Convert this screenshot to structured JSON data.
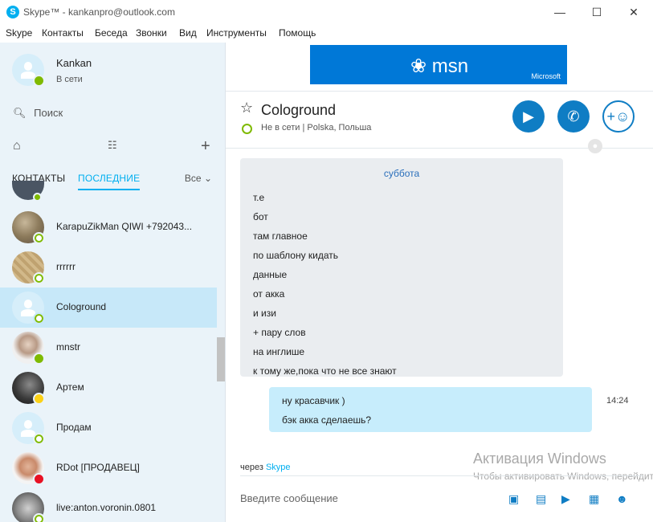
{
  "window": {
    "title": "Skype™ - kankanpro@outlook.com",
    "minimize": "—",
    "maximize": "☐",
    "close": "✕"
  },
  "menu": [
    "Skype",
    "Контакты",
    "Беседа",
    "Звонки",
    "Вид",
    "Инструменты",
    "Помощь"
  ],
  "profile": {
    "name": "Kankan",
    "status": "В сети"
  },
  "search": {
    "placeholder": "Поиск"
  },
  "tabs": {
    "contacts": "КОНТАКТЫ",
    "recent": "ПОСЛЕДНИЕ",
    "filter": "Все"
  },
  "contacts": [
    {
      "name": "KarapuZikMan QIWI +792043...",
      "status": "offline",
      "avatar": "photo"
    },
    {
      "name": "rrrrrr",
      "status": "offline",
      "avatar": "photo"
    },
    {
      "name": "Cologround",
      "status": "offline",
      "avatar": "default"
    },
    {
      "name": "mnstr",
      "status": "online",
      "avatar": "photo"
    },
    {
      "name": "Артем",
      "status": "away",
      "avatar": "photo"
    },
    {
      "name": "Продам",
      "status": "offline",
      "avatar": "default"
    },
    {
      "name": "RDot [ПРОДАВЕЦ]",
      "status": "dnd",
      "avatar": "photo"
    },
    {
      "name": "live:anton.voronin.0801",
      "status": "offline",
      "avatar": "photo"
    }
  ],
  "ad": {
    "brand": "msn",
    "sponsor": "Microsoft"
  },
  "chat": {
    "contact_name": "Cologround",
    "contact_status": "Не в сети  |  Polska, Польша",
    "day_separator": "суббота",
    "incoming_lines": [
      "т.е",
      "бот",
      "там главное",
      "по шаблону кидать",
      "данные",
      "от акка",
      "и изи",
      "+ пару слов",
      "на инглише",
      "к тому же,пока что не все знают"
    ],
    "outgoing_lines": [
      "ну красавчик )",
      "бэк акка сделаешь?"
    ],
    "outgoing_time": "14:24",
    "via_prefix": "через",
    "via_app": "Skype",
    "input_placeholder": "Введите сообщение"
  },
  "watermark": {
    "title": "Активация Windows",
    "text": "Чтобы активировать Windows, перейдите в раздел \"Параметры\"."
  },
  "colors": {
    "accent": "#00aff0",
    "call": "#0f7dc4",
    "online": "#7fba00",
    "dnd": "#e81123",
    "away": "#fcd116"
  }
}
